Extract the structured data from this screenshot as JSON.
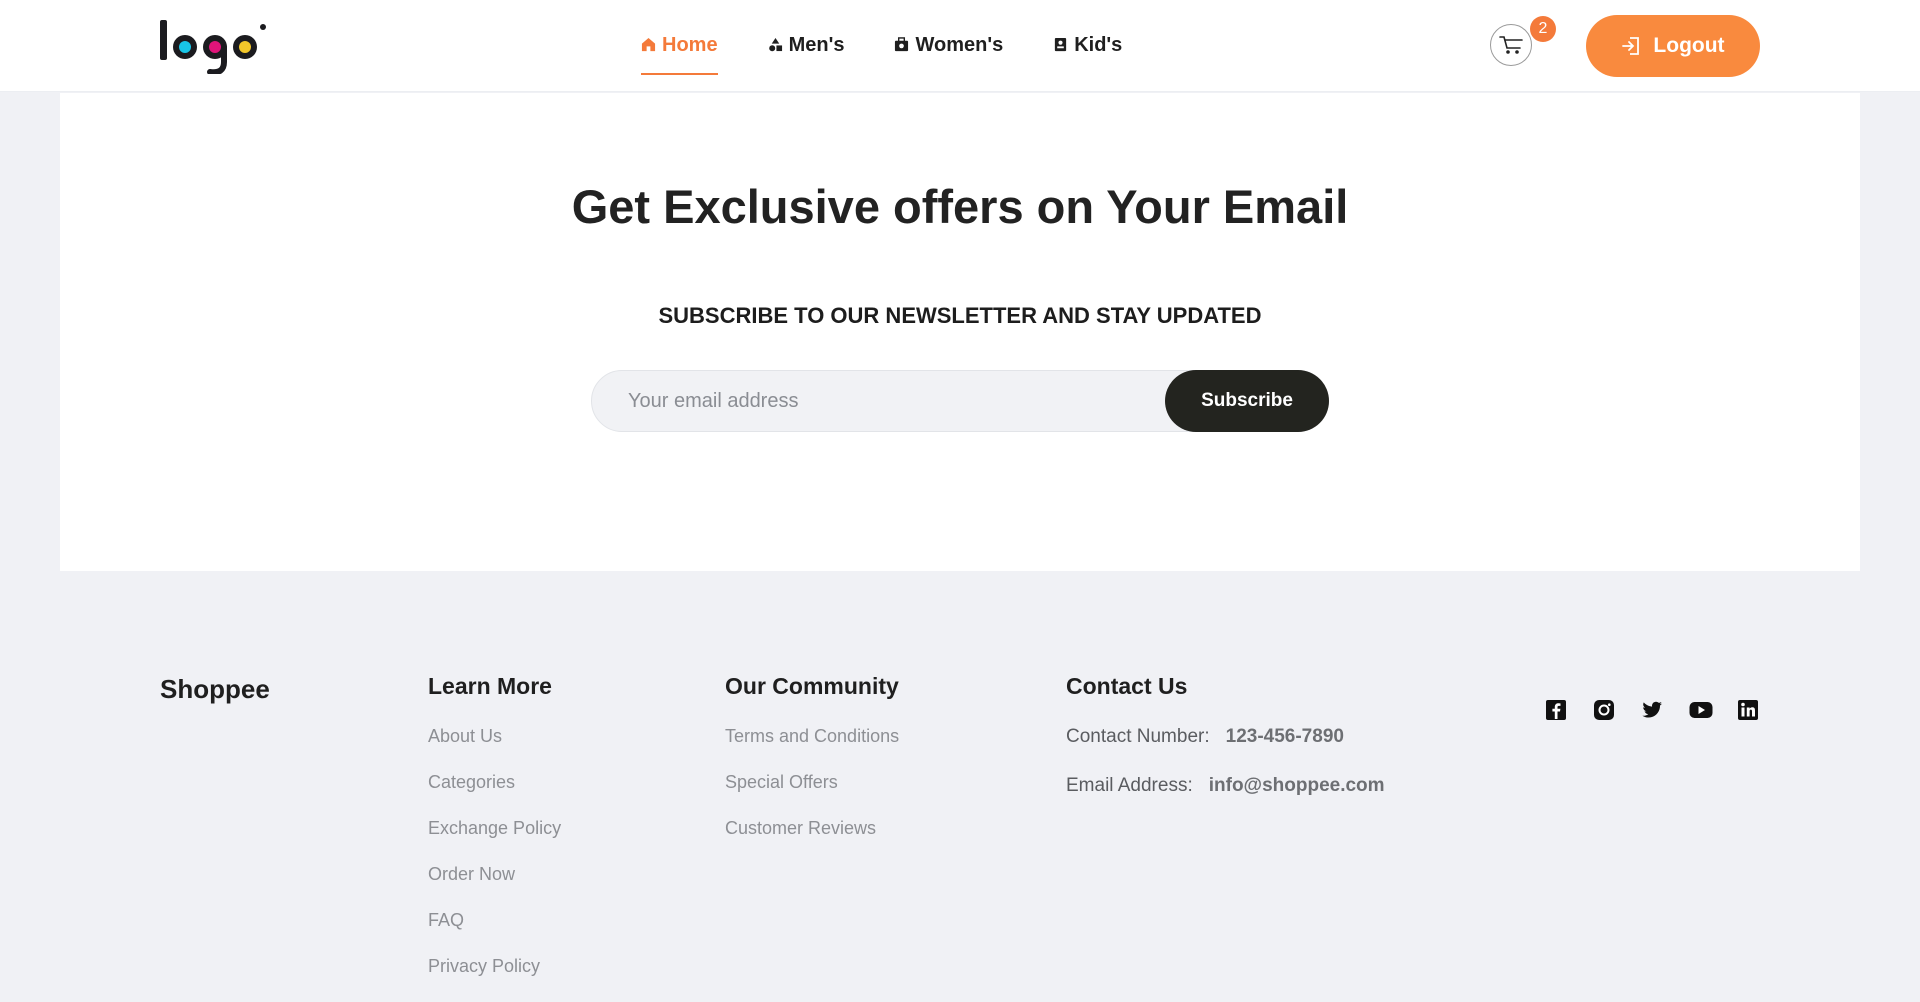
{
  "header": {
    "logo_text": "logo",
    "nav": [
      {
        "label": "Home",
        "icon": "home-icon",
        "active": true
      },
      {
        "label": "Men's",
        "icon": "shapes-icon"
      },
      {
        "label": "Women's",
        "icon": "bag-icon"
      },
      {
        "label": "Kid's",
        "icon": "contact-card-icon"
      }
    ],
    "cart_count": "2",
    "logout_label": "Logout"
  },
  "newsletter": {
    "title": "Get Exclusive offers on Your Email",
    "subtitle": "SUBSCRIBE TO OUR NEWSLETTER AND STAY UPDATED",
    "email_placeholder": "Your email address",
    "subscribe_label": "Subscribe"
  },
  "footer": {
    "brand": "Shoppee",
    "learn_more": {
      "heading": "Learn More",
      "links": [
        "About Us",
        "Categories",
        "Exchange Policy",
        "Order Now",
        "FAQ",
        "Privacy Policy"
      ]
    },
    "community": {
      "heading": "Our Community",
      "links": [
        "Terms and Conditions",
        "Special Offers",
        "Customer Reviews"
      ]
    },
    "contact": {
      "heading": "Contact Us",
      "phone_label": "Contact Number:",
      "phone": "123-456-7890",
      "email_label": "Email Address:",
      "email": "info@shoppee.com"
    },
    "social": [
      "facebook-icon",
      "instagram-icon",
      "twitter-icon",
      "youtube-icon",
      "linkedin-icon"
    ]
  },
  "colors": {
    "accent": "#f47a3a",
    "logout_bg": "#f98a3e",
    "subscribe_bg": "#23241f",
    "page_bg": "#f0f1f5"
  }
}
